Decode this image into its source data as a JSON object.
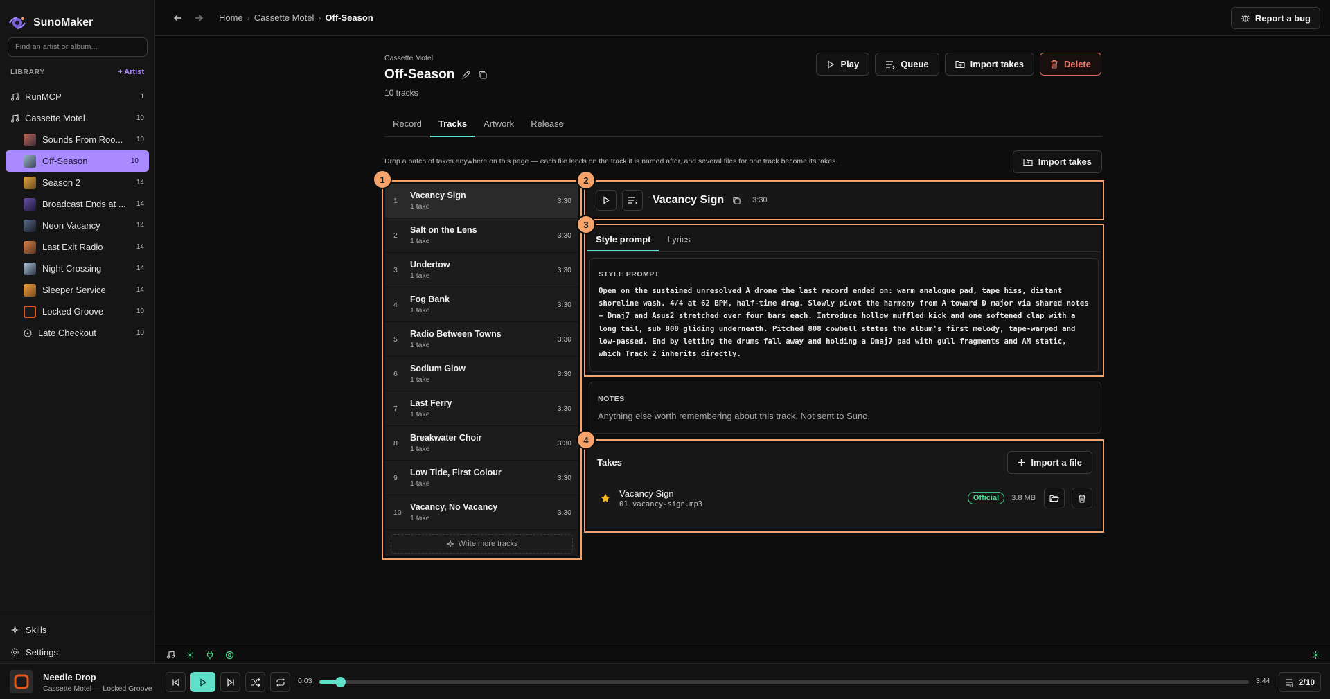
{
  "app": {
    "name": "SunoMaker"
  },
  "sidebar": {
    "search_placeholder": "Find an artist or album...",
    "library_label": "LIBRARY",
    "add_artist": "+ Artist",
    "items": [
      {
        "label": "RunMCP",
        "count": "1"
      },
      {
        "label": "Cassette Motel",
        "count": "10"
      },
      {
        "label": "Sounds From Roo...",
        "count": "10"
      },
      {
        "label": "Off-Season",
        "count": "10"
      },
      {
        "label": "Season 2",
        "count": "14"
      },
      {
        "label": "Broadcast Ends at ...",
        "count": "14"
      },
      {
        "label": "Neon Vacancy",
        "count": "14"
      },
      {
        "label": "Last Exit Radio",
        "count": "14"
      },
      {
        "label": "Night Crossing",
        "count": "14"
      },
      {
        "label": "Sleeper Service",
        "count": "14"
      },
      {
        "label": "Locked Groove",
        "count": "10"
      },
      {
        "label": "Late Checkout",
        "count": "10"
      }
    ],
    "skills": "Skills",
    "settings": "Settings"
  },
  "topbar": {
    "breadcrumb": [
      "Home",
      "Cassette Motel",
      "Off-Season"
    ],
    "report_bug": "Report a bug"
  },
  "album": {
    "artist": "Cassette Motel",
    "title": "Off-Season",
    "track_count": "10 tracks",
    "actions": {
      "play": "Play",
      "queue": "Queue",
      "import": "Import takes",
      "delete": "Delete"
    },
    "tabs": [
      "Record",
      "Tracks",
      "Artwork",
      "Release"
    ],
    "drop_hint": "Drop a batch of takes anywhere on this page — each file lands on the track it is named after, and several files for one track become its takes.",
    "import_takes": "Import takes"
  },
  "annotations": [
    "1",
    "2",
    "3",
    "4"
  ],
  "tracks": [
    {
      "num": "1",
      "name": "Vacancy Sign",
      "takes": "1 take",
      "dur": "3:30"
    },
    {
      "num": "2",
      "name": "Salt on the Lens",
      "takes": "1 take",
      "dur": "3:30"
    },
    {
      "num": "3",
      "name": "Undertow",
      "takes": "1 take",
      "dur": "3:30"
    },
    {
      "num": "4",
      "name": "Fog Bank",
      "takes": "1 take",
      "dur": "3:30"
    },
    {
      "num": "5",
      "name": "Radio Between Towns",
      "takes": "1 take",
      "dur": "3:30"
    },
    {
      "num": "6",
      "name": "Sodium Glow",
      "takes": "1 take",
      "dur": "3:30"
    },
    {
      "num": "7",
      "name": "Last Ferry",
      "takes": "1 take",
      "dur": "3:30"
    },
    {
      "num": "8",
      "name": "Breakwater Choir",
      "takes": "1 take",
      "dur": "3:30"
    },
    {
      "num": "9",
      "name": "Low Tide, First Colour",
      "takes": "1 take",
      "dur": "3:30"
    },
    {
      "num": "10",
      "name": "Vacancy, No Vacancy",
      "takes": "1 take",
      "dur": "3:30"
    }
  ],
  "write_more": "Write more tracks",
  "selected_track": {
    "title": "Vacancy Sign",
    "duration": "3:30",
    "tabs": [
      "Style prompt",
      "Lyrics"
    ],
    "style_label": "STYLE PROMPT",
    "style_prompt": "Open on the sustained unresolved A drone the last record ended on: warm analogue pad, tape hiss, distant shoreline wash. 4/4 at 62 BPM, half-time drag. Slowly pivot the harmony from A toward D major via shared notes — Dmaj7 and Asus2 stretched over four bars each. Introduce hollow muffled kick and one softened clap with a long tail, sub 808 gliding underneath. Pitched 808 cowbell states the album's first melody, tape-warped and low-passed. End by letting the drums fall away and holding a Dmaj7 pad with gull fragments and AM static, which Track 2 inherits directly.",
    "notes_label": "NOTES",
    "notes_placeholder": "Anything else worth remembering about this track. Not sent to Suno.",
    "takes_title": "Takes",
    "import_file": "Import a file",
    "take": {
      "name": "Vacancy Sign",
      "file": "01 vacancy-sign.mp3",
      "badge": "Official",
      "size": "3.8 MB"
    }
  },
  "player": {
    "title": "Needle Drop",
    "subtitle": "Cassette Motel — Locked Groove",
    "elapsed": "0:03",
    "total": "3:44",
    "progress": 0.022,
    "queue": "2/10"
  },
  "colors": {
    "accent": "#5fe0c9",
    "active": "#a98bff",
    "danger": "#f07b70",
    "annotation": "#f5a36b",
    "official": "#4fd68f"
  }
}
